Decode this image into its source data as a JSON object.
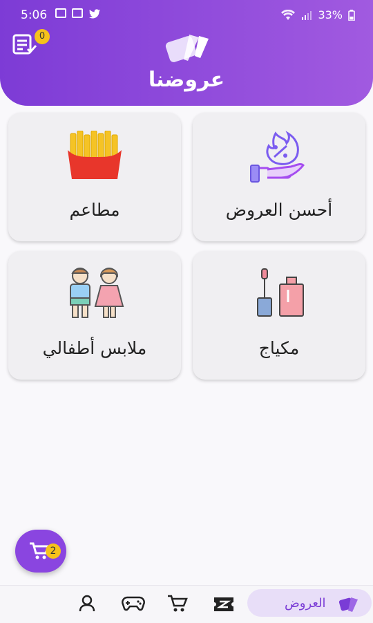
{
  "status_bar": {
    "time": "5:06",
    "battery": "33%"
  },
  "header": {
    "title": "عروضنا",
    "orders_badge": "0"
  },
  "categories": [
    {
      "label": "أحسن العروض",
      "icon": "discount-hand-icon"
    },
    {
      "label": "مطاعم",
      "icon": "fries-icon"
    },
    {
      "label": "مكياج",
      "icon": "makeup-icon"
    },
    {
      "label": "ملابس أطفالي",
      "icon": "kids-icon"
    }
  ],
  "cart": {
    "badge": "2"
  },
  "bottom_nav": {
    "active_label": "العروض",
    "items": [
      "offers-icon",
      "coupon-icon",
      "cart-icon",
      "gamepad-icon",
      "profile-icon"
    ]
  },
  "colors": {
    "accent": "#8a45e0",
    "badge": "#f6c21b"
  }
}
